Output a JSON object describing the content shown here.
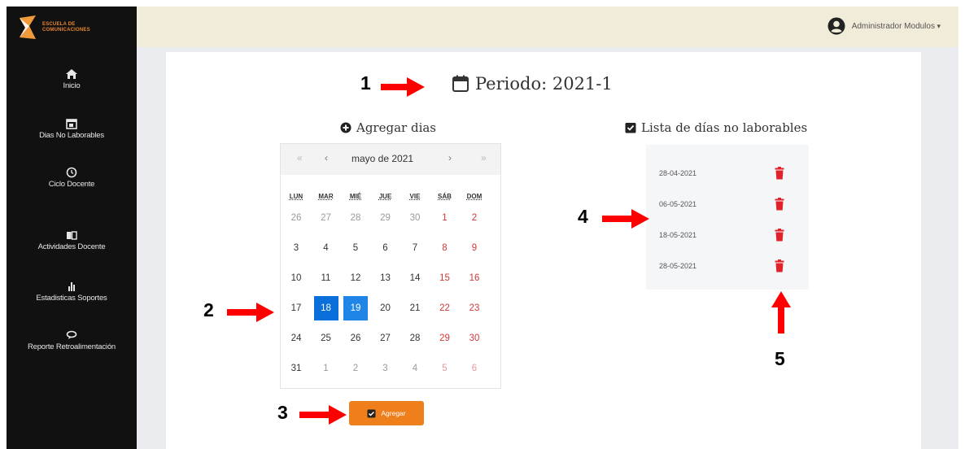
{
  "sidebar": {
    "logo_line1": "ESCUELA DE",
    "logo_line2": "COMUNICACIONES",
    "items": [
      {
        "label": "Inicio",
        "icon": "home-icon"
      },
      {
        "label": "Dias No Laborables",
        "icon": "calendar-icon"
      },
      {
        "label": "Ciclo Docente",
        "icon": "clock-icon"
      },
      {
        "label": "Actividades Docente",
        "icon": "book-icon"
      },
      {
        "label": "Estadisticas Soportes",
        "icon": "bar-chart-icon"
      },
      {
        "label": "Reporte Retroalimentación",
        "icon": "chat-icon"
      }
    ]
  },
  "header": {
    "user_name": "Administrador Modulos",
    "user_icon": "user-circle-icon"
  },
  "main": {
    "title": "Periodo: 2021-1",
    "add_section_title": "Agregar dias",
    "list_section_title": "Lista de días no laborables",
    "add_button_label": "Agregar"
  },
  "calendar": {
    "month_label": "mayo de 2021",
    "nav": {
      "prev_year": "«",
      "prev_month": "‹",
      "next_month": "›",
      "next_year": "»"
    },
    "weekdays": [
      "LUN",
      "MAR",
      "MIÉ",
      "JUE",
      "VIE",
      "SÁB",
      "DOM"
    ],
    "weeks": [
      [
        "26",
        "27",
        "28",
        "29",
        "30",
        "1",
        "2"
      ],
      [
        "3",
        "4",
        "5",
        "6",
        "7",
        "8",
        "9"
      ],
      [
        "10",
        "11",
        "12",
        "13",
        "14",
        "15",
        "16"
      ],
      [
        "17",
        "18",
        "19",
        "20",
        "21",
        "22",
        "23"
      ],
      [
        "24",
        "25",
        "26",
        "27",
        "28",
        "29",
        "30"
      ],
      [
        "31",
        "1",
        "2",
        "3",
        "4",
        "5",
        "6"
      ]
    ],
    "selected_days": [
      "18",
      "19"
    ],
    "selected_color": "#0a6fdb",
    "weekend_color": "#d13a3a"
  },
  "non_working_days": [
    "28-04-2021",
    "06-05-2021",
    "18-05-2021",
    "28-05-2021"
  ],
  "annotations": [
    "1",
    "2",
    "3",
    "4",
    "5"
  ],
  "colors": {
    "sidebar_bg": "#111111",
    "topbar_bg": "#f1ecd9",
    "accent_orange": "#ef7f1b",
    "trash_red": "#e0222b",
    "annotation_red": "#ff0000"
  }
}
